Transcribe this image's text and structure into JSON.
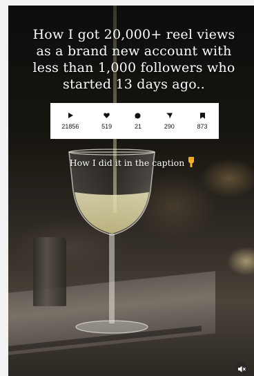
{
  "post": {
    "headline": "How I got 20,000+ reel views as a brand new account with less than 1,000 followers who started 13 days ago..",
    "caption_note": "How I did it in the caption"
  },
  "stats": [
    {
      "icon": "play-icon",
      "value": "21856"
    },
    {
      "icon": "heart-icon",
      "value": "519"
    },
    {
      "icon": "comment-icon",
      "value": "21"
    },
    {
      "icon": "share-icon",
      "value": "290"
    },
    {
      "icon": "bookmark-icon",
      "value": "873"
    }
  ],
  "icons": {
    "pointing-hand": "pointing-down-hand-icon",
    "mute": "mute-icon"
  },
  "colors": {
    "text": "#ffffff",
    "stats_background": "#ffffff",
    "emoji": "#f2b233"
  }
}
